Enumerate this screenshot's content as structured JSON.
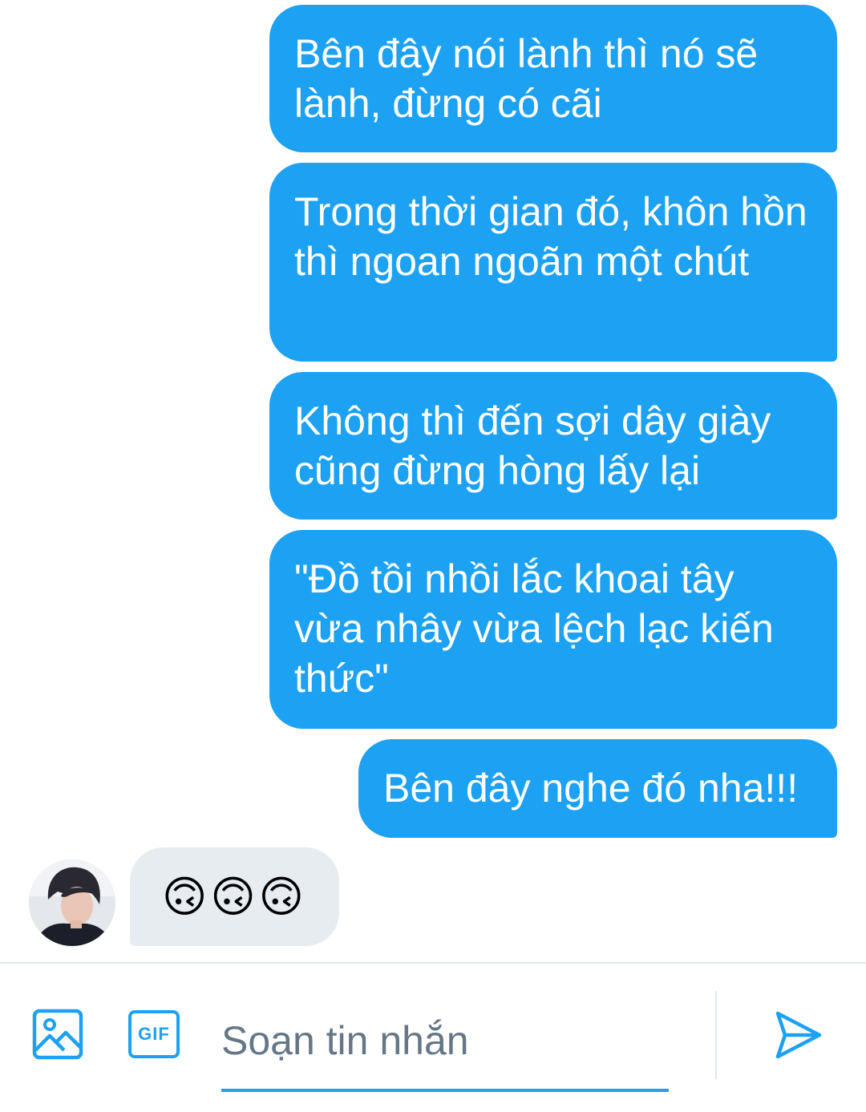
{
  "messages": {
    "outgoing": [
      {
        "text": "Bên đây nói lành thì nó sẽ lành, đừng có cãi"
      },
      {
        "text": "Trong thời gian đó, khôn hồn thì ngoan ngoãn một chút"
      },
      {
        "text": "Không thì đến sợi dây giày cũng đừng hòng lấy lại"
      },
      {
        "text": "\"Đồ tồi nhồi lắc khoai tây vừa nhây vừa lệch lạc kiến thức\""
      },
      {
        "text": "Bên đây nghe đó nha!!!"
      }
    ],
    "incoming": {
      "text": "🙃🙃🙃"
    }
  },
  "composer": {
    "placeholder": "Soạn tin nhắn",
    "value": "",
    "gif_label": "GIF",
    "icons": {
      "image": "image-icon",
      "send": "send-icon"
    }
  },
  "colors": {
    "accent": "#1da1f2",
    "incoming_bubble": "#e6ecf0",
    "placeholder": "#657786",
    "divider": "#e1e8ed"
  }
}
